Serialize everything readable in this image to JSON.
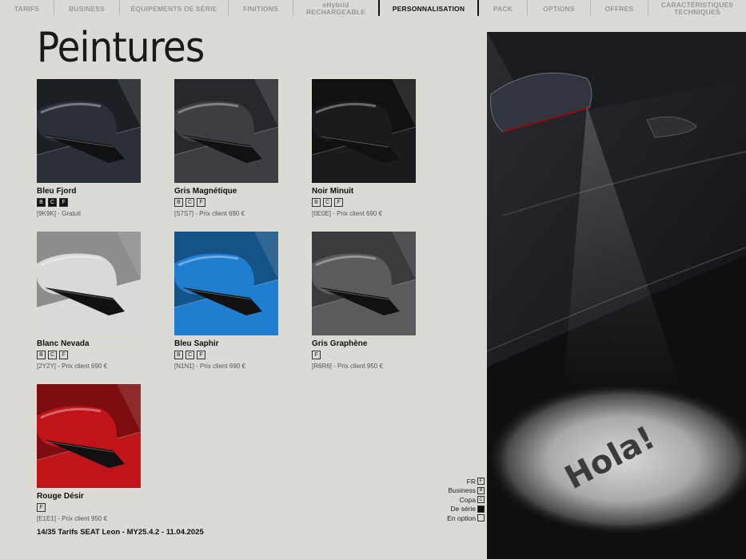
{
  "nav": {
    "items": [
      {
        "label": "TARIFS"
      },
      {
        "label": "BUSINESS"
      },
      {
        "label": "ÉQUIPEMENTS DE SÉRIE"
      },
      {
        "label": "FINITIONS"
      },
      {
        "label_top": "eHybrid",
        "label": "RECHARGEABLE"
      },
      {
        "label": "PERSONNALISATION",
        "active": true
      },
      {
        "label": "PACK"
      },
      {
        "label": "OPTIONS"
      },
      {
        "label": "OFFRES"
      },
      {
        "label_top": "CARACTÉRISTIQUES",
        "label": "TECHNIQUES"
      }
    ]
  },
  "title": "Peintures",
  "swatches": [
    {
      "name": "Bleu Fjord",
      "codes": [
        "B",
        "C",
        "F"
      ],
      "filled": true,
      "price": "[9K9K] - Gratuit",
      "color": "#2b3038"
    },
    {
      "name": "Gris Magnétique",
      "codes": [
        "B",
        "C",
        "F"
      ],
      "filled": false,
      "price": "[S7S7] - Prix client 690 €",
      "color": "#3c3e42"
    },
    {
      "name": "Noir Minuit",
      "codes": [
        "B",
        "C",
        "F"
      ],
      "filled": false,
      "price": "[0E0E] - Prix client 690 €",
      "color": "#1b1b1d"
    },
    {
      "name": "Blanc Nevada",
      "codes": [
        "B",
        "C",
        "F"
      ],
      "filled": false,
      "price": "[2Y2Y] - Prix client 690 €",
      "color": "#d8d9d9"
    },
    {
      "name": "Bleu Saphir",
      "codes": [
        "B",
        "C",
        "F"
      ],
      "filled": false,
      "price": "[N1N1] - Prix client 690 €",
      "color": "#1f7ed0"
    },
    {
      "name": "Gris Graphène",
      "codes": [
        "F"
      ],
      "filled": false,
      "price": "[R6R6] - Prix client 950 €",
      "color": "#5a5b5d"
    },
    {
      "name": "Rouge Désir",
      "codes": [
        "F"
      ],
      "filled": false,
      "price": "[E1E1] - Prix client 950 €",
      "color": "#c0141b"
    }
  ],
  "photo_text": "Hola!",
  "legend": [
    {
      "label": "FR",
      "box": "F",
      "filled": false
    },
    {
      "label": "Business",
      "box": "B",
      "filled": false
    },
    {
      "label": "Copa",
      "box": "C",
      "filled": false
    },
    {
      "label": "De série",
      "box": "",
      "filled": true
    },
    {
      "label": "En option",
      "box": "",
      "filled": false
    }
  ],
  "footer": "14/35   Tarifs SEAT Leon - MY25.4.2 - 11.04.2025"
}
